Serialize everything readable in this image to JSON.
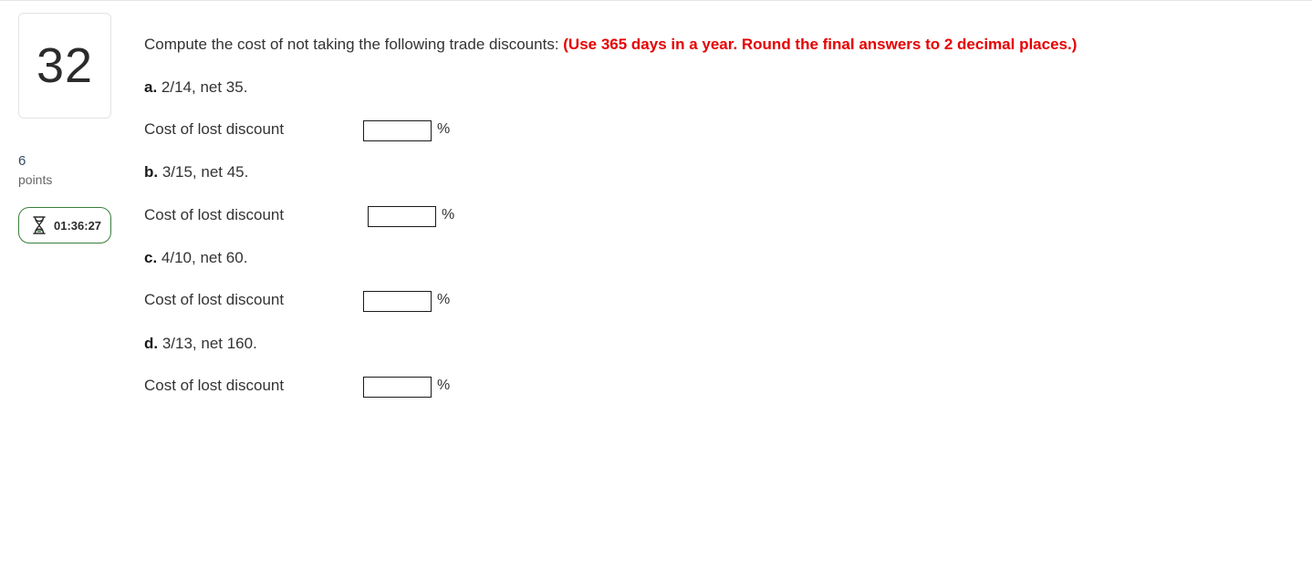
{
  "question": {
    "number": "32",
    "points_value": "6",
    "points_label": "points",
    "timer": "01:36:27",
    "prompt_text": "Compute the cost of not taking the following trade discounts: ",
    "prompt_instruction": "(Use 365 days in a year. Round the final answers to 2 decimal places.)"
  },
  "parts": [
    {
      "letter": "a.",
      "terms": " 2/14, net 35.",
      "row_label": "Cost of lost discount",
      "value": "",
      "unit": "%"
    },
    {
      "letter": "b.",
      "terms": " 3/15, net 45.",
      "row_label": "Cost of lost discount",
      "value": "",
      "unit": "%"
    },
    {
      "letter": "c.",
      "terms": " 4/10, net 60.",
      "row_label": "Cost of lost discount",
      "value": "",
      "unit": "%"
    },
    {
      "letter": "d.",
      "terms": " 3/13, net 160.",
      "row_label": "Cost of lost discount",
      "value": "",
      "unit": "%"
    }
  ],
  "icons": {
    "timer": "hourglass-icon"
  },
  "colors": {
    "instruction": "#e60000",
    "timer_border": "#3a7d3a",
    "text": "#333333"
  }
}
